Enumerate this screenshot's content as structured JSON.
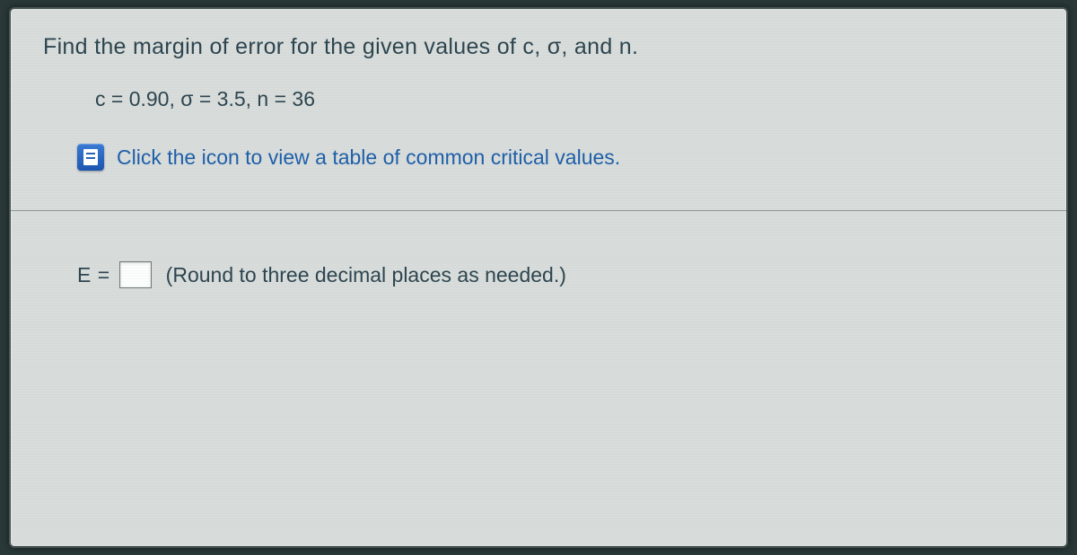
{
  "question": {
    "title": "Find the margin of error for the given values of c, σ, and n.",
    "params": "c = 0.90, σ = 3.5, n = 36",
    "link": "Click the icon to view a table of common critical values."
  },
  "answer": {
    "prefix": "E =",
    "value": "",
    "hint": "(Round to three decimal places as needed.)"
  }
}
